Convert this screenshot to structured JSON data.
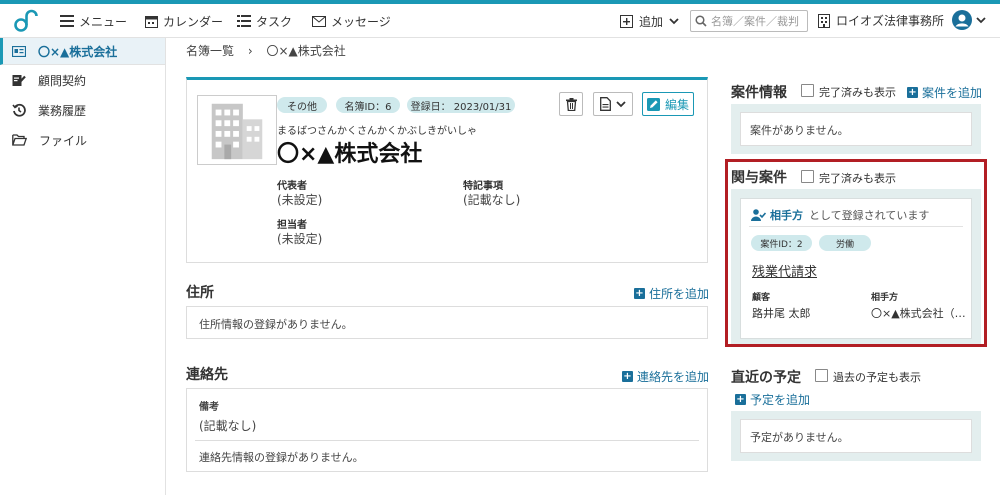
{
  "topbar": {
    "menu": "メニュー",
    "calendar": "カレンダー",
    "task": "タスク",
    "message": "メッセージ",
    "add": "追加",
    "search_placeholder": "名簿／案件／裁判",
    "firm": "ロイオズ法律事務所"
  },
  "sidebar": {
    "items": [
      {
        "label": "〇×▲株式会社"
      },
      {
        "label": "顧問契約"
      },
      {
        "label": "業務履歴"
      },
      {
        "label": "ファイル"
      }
    ]
  },
  "breadcrumb": {
    "root": "名簿一覧",
    "sep": "›",
    "current": "〇×▲株式会社"
  },
  "profile": {
    "tags": {
      "category": "その他",
      "id": "名簿ID：6",
      "registered": "登録日： 2023/01/31"
    },
    "edit_label": "編集",
    "kana": "まるばつさんかくさんかくかぶしきがいしゃ",
    "name": "〇×▲株式会社",
    "rep_label": "代表者",
    "rep_value": "(未設定)",
    "notes_label": "特記事項",
    "notes_value": "(記載なし)",
    "staff_label": "担当者",
    "staff_value": "(未設定)"
  },
  "address": {
    "title": "住所",
    "add": "住所を追加",
    "empty": "住所情報の登録がありません。"
  },
  "contact": {
    "title": "連絡先",
    "add": "連絡先を追加",
    "memo_label": "備考",
    "memo_value": "(記載なし)",
    "empty": "連絡先情報の登録がありません。"
  },
  "cases": {
    "title": "案件情報",
    "show_done": "完了済みも表示",
    "add": "案件を追加",
    "empty": "案件がありません。"
  },
  "related": {
    "title": "関与案件",
    "show_done": "完了済みも表示",
    "role": "相手方",
    "role_suffix": "として登録されています",
    "case_id": "案件ID：2",
    "category": "労働",
    "case_name": "残業代請求",
    "client_label": "顧客",
    "client_value": "路井尾 太郎",
    "opponent_label": "相手方",
    "opponent_value": "〇×▲株式会社（…"
  },
  "schedule": {
    "title": "直近の予定",
    "show_past": "過去の予定も表示",
    "add": "予定を追加",
    "empty": "予定がありません。"
  }
}
